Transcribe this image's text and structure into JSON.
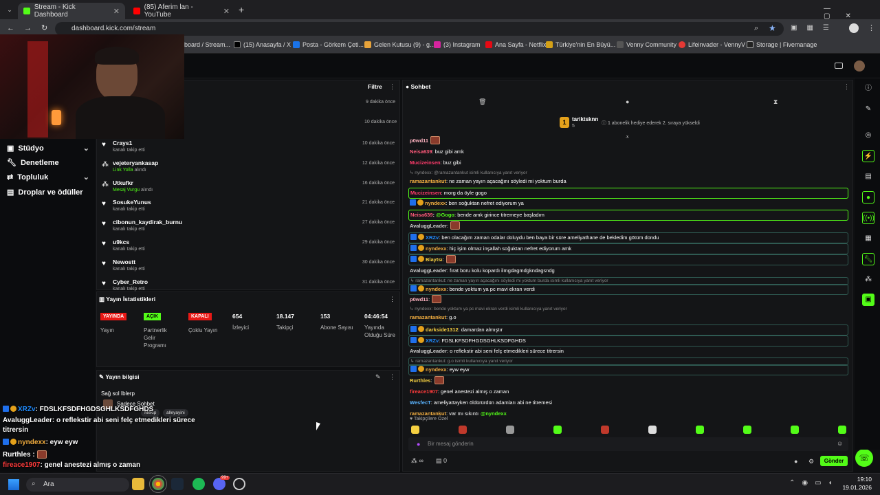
{
  "browser": {
    "tabs": [
      {
        "title": "Stream - Kick Dashboard"
      },
      {
        "title": "(85) Aferim lan - YouTube"
      }
    ],
    "new_tab": "+",
    "url": "dashboard.kick.com/stream",
    "bookmarks": [
      {
        "label": "board / Stream..."
      },
      {
        "label": "(15) Anasayfa / X"
      },
      {
        "label": "Posta - Görkem Çeti..."
      },
      {
        "label": "Gelen Kutusu (9) - g..."
      },
      {
        "label": "(3) Instagram"
      },
      {
        "label": "Ana Sayfa - Netflix"
      },
      {
        "label": "Türkiye'nin En Büyü..."
      },
      {
        "label": "Venny Community"
      },
      {
        "label": "Lifeinvader - VennyV"
      },
      {
        "label": "Storage | Fivemanage"
      }
    ]
  },
  "sidebar": {
    "items": [
      {
        "label": "Stüdyo"
      },
      {
        "label": "Denetleme"
      },
      {
        "label": "Topluluk"
      },
      {
        "label": "Droplar ve ödüller"
      }
    ]
  },
  "activity": {
    "filter_label": "Filtre",
    "top_times": [
      "9 dakika önce",
      "10 dakika önce"
    ],
    "rows": [
      {
        "name": "Crays1",
        "sub": "kanalı takip etti",
        "time": "10 dakika önce"
      },
      {
        "name": "vejeteryankasap",
        "sub_hl": "Link Yolla",
        "sub": " alındı",
        "time": "12 dakika önce"
      },
      {
        "name": "Utkufkr",
        "sub_hl": "Mesaj Vurgu",
        "sub": " alındı",
        "time": "16 dakika önce"
      },
      {
        "name": "SosukeYunus",
        "sub": "kanalı takip etti",
        "time": "21 dakika önce"
      },
      {
        "name": "cibonun_kaydirak_burnu",
        "sub": "kanalı takip etti",
        "time": "27 dakika önce"
      },
      {
        "name": "u9kcs",
        "sub": "kanalı takip etti",
        "time": "29 dakika önce"
      },
      {
        "name": "Newostt",
        "sub": "kanalı takip etti",
        "time": "30 dakika önce"
      },
      {
        "name": "Cyber_Retro",
        "sub": "kanalı takip etti",
        "time": "31 dakika önce"
      }
    ]
  },
  "stats": {
    "title": "Yayın İstatistikleri",
    "badges": [
      {
        "badge": "YAYINDA",
        "label": "Yayın",
        "color": "#e91916"
      },
      {
        "badge": "AÇIK",
        "label": "Partnerlik Gelir Programı",
        "color": "#53fc18"
      },
      {
        "badge": "KAPALI",
        "label": "Çoklu Yayın",
        "color": "#e91916"
      }
    ],
    "values": [
      {
        "value": "654",
        "label": "İzleyici"
      },
      {
        "value": "18.147",
        "label": "Takipçi"
      },
      {
        "value": "153",
        "label": "Abone Sayısı"
      },
      {
        "value": "04:46:54",
        "label": "Yayında Olduğu Süre"
      }
    ]
  },
  "stream_info": {
    "title": "Yayın bilgisi",
    "stream_title": "Sağ sol Iblerp",
    "category": "Sadece Sohbet",
    "tags": [
      "Mekip",
      "alleyayini"
    ]
  },
  "chat": {
    "title": "Sohbet",
    "pinned_user": "tariktsknn",
    "pinned_count": "5",
    "pinned_text": "1 abonelik hediye ederek 2. sıraya yükseldi",
    "messages": [
      {
        "type": "msg",
        "user": "p0wd11",
        "color": "#ffb3c1",
        "text": "",
        "emote": true,
        "partial": true
      },
      {
        "type": "msg",
        "user": "Neisa639",
        "color": "#ff5a7a",
        "text": ": buz gibi amk"
      },
      {
        "type": "msg",
        "user": "Mucizeinsen",
        "color": "#ff3b6b",
        "text": ": buz gibi"
      },
      {
        "type": "reply",
        "text": "↳ nyndexx: @ramazantankut isimli kullanıcıya yanıt veriyor"
      },
      {
        "type": "msg",
        "user": "ramazantankut",
        "color": "#f5b041",
        "text": ": ne zaman yayın açacağını söyledi mi yoktum burda"
      },
      {
        "type": "msg",
        "user": "Mucizeinsen",
        "color": "#ff3b6b",
        "text": ": morg da öyle gogo",
        "style": "hlg"
      },
      {
        "type": "msg",
        "user": "nyndexx",
        "color": "#f5b041",
        "text": ": ben soğuktan nefret ediyorum ya",
        "icons": true
      },
      {
        "type": "msg",
        "user": "Neisa639",
        "color": "#ff5a7a",
        "text": ": bende amk girince titremeye başladım",
        "style": "hlg",
        "mention": "@Gogo"
      },
      {
        "type": "msg",
        "user": "AvaluggLeader",
        "color": "#cfcfcf",
        "text": ":",
        "emote": true
      },
      {
        "type": "msg",
        "user": "XRZv",
        "color": "#1f8cff",
        "text": ": ben olacağım zaman odalar doluydu ben baya bir süre ameliyathane de bekledim götüm dondu",
        "style": "hl",
        "icons": true
      },
      {
        "type": "msg",
        "user": "nyndexx",
        "color": "#f5b041",
        "text": ": hiç işim olmaz inşallah soğuktan nefret ediyorum amk",
        "style": "hl",
        "icons": true
      },
      {
        "type": "msg",
        "user": "Blaytsı",
        "color": "#f5d041",
        "text": ":",
        "emote": true,
        "style": "hl",
        "icons": true
      },
      {
        "type": "msg",
        "user": "AvaluggLeader",
        "color": "#cfcfcf",
        "text": ": fırat boru kolu kopardı ilmgdagmdgkndagsndg"
      },
      {
        "type": "reply",
        "text": "↳ ramazantankut: ne zaman yayın açacağını söyledi mi yoktum burda isimli kullanıcıya yanıt veriyor",
        "style": "hl"
      },
      {
        "type": "msg",
        "user": "nyndexx",
        "color": "#f5b041",
        "text": ": bende yoktum ya pc mavi ekran verdi",
        "style": "hl",
        "icons": true
      },
      {
        "type": "msg",
        "user": "p0wd11",
        "color": "#ffb3c1",
        "text": ":",
        "emote": true
      },
      {
        "type": "reply",
        "text": "↳ nyndexx: bende yoktum ya pc mavi ekran verdi isimli kullanıcıya yanıt veriyor"
      },
      {
        "type": "msg",
        "user": "ramazantankut",
        "color": "#f5b041",
        "text": ": g.o"
      },
      {
        "type": "msg",
        "user": "darkside1312",
        "color": "#f5d041",
        "text": ": damardan almıştır",
        "style": "hl",
        "icons": true
      },
      {
        "type": "msg",
        "user": "XRZv",
        "color": "#1f8cff",
        "text": ": FDSLKFSDFHGDSGHLKSDFGHDS",
        "style": "hl",
        "icons": true
      },
      {
        "type": "msg",
        "user": "AvaluggLeader",
        "color": "#cfcfcf",
        "text": ": o reflekstir abi seni felç etmedikleri sürece titrersin"
      },
      {
        "type": "reply",
        "text": "↳ ramazantankut: g.o isimli kullanıcıya yanıt veriyor",
        "style": "hl"
      },
      {
        "type": "msg",
        "user": "nyndexx",
        "color": "#f5b041",
        "text": ": eyw eyw",
        "style": "hl",
        "icons": true
      },
      {
        "type": "msg",
        "user": "Rurthles",
        "color": "#f5d041",
        "text": ":",
        "emote": true
      },
      {
        "type": "msg",
        "user": "fireace1907",
        "color": "#ff3b3b",
        "text": ": genel anestezi almış o zaman"
      },
      {
        "type": "msg",
        "user": "WesfecT",
        "color": "#5ab4ff",
        "text": ": ameliyattayken öldürürdün adamları abi ne titremesi"
      },
      {
        "type": "msg",
        "user": "ramazantankut",
        "color": "#f5b041",
        "text": ": var mı sıkıntı",
        "mention_after": "@nyndexx"
      }
    ],
    "followers_only": "Takipçilere Özel",
    "input_placeholder": "Bir mesaj gönderin",
    "infinite": "∞",
    "points": "0",
    "send_label": "Gönder"
  },
  "overlay_chat": [
    {
      "user": "XRZv",
      "text": ": FDSLKFSDFHGDSGHLKSDFGHDS",
      "color": "#1f8cff"
    },
    {
      "user": "AvaluggLeader",
      "text": ": o reflekstir abi seni felç etmedikleri sürece",
      "color": "#ffffff"
    },
    {
      "user": "",
      "text": "titrersin",
      "color": "#ffffff"
    },
    {
      "user": "nyndexx",
      "text": ": eyw eyw",
      "color": "#f5b041"
    },
    {
      "user": "Rurthles",
      "text": " :",
      "color": "#ffffff"
    },
    {
      "user": "fireace1907",
      "text": ": genel anestezi almış o zaman",
      "color": "#ff3b3b"
    },
    {
      "user": "WesfecT",
      "text": ": ameliyattayken öldürürdün adamları abi ne titremesi",
      "color": "#5ab4ff"
    }
  ],
  "taskbar": {
    "search": "Ara",
    "time": "19:10",
    "date": "19.01.2026",
    "badge": "99+"
  }
}
